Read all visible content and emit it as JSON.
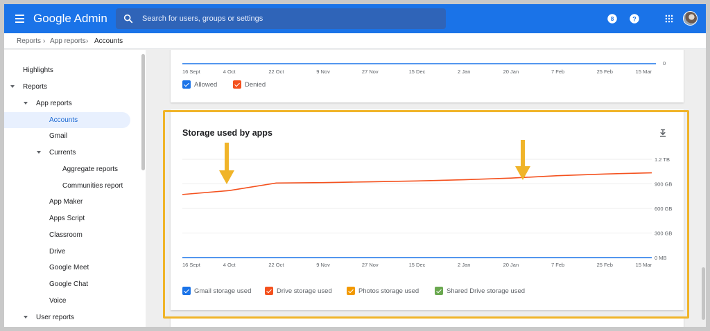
{
  "header": {
    "app_title": "Google Admin",
    "search_placeholder": "Search for users, groups or settings"
  },
  "breadcrumb": [
    "Reports",
    "App reports",
    "Accounts"
  ],
  "sidebar": {
    "items": [
      {
        "label": "Highlights"
      },
      {
        "label": "Reports"
      },
      {
        "label": "App reports"
      },
      {
        "label": "Accounts"
      },
      {
        "label": "Gmail"
      },
      {
        "label": "Currents"
      },
      {
        "label": "Aggregate reports"
      },
      {
        "label": "Communities report"
      },
      {
        "label": "App Maker"
      },
      {
        "label": "Apps Script"
      },
      {
        "label": "Classroom"
      },
      {
        "label": "Drive"
      },
      {
        "label": "Google Meet"
      },
      {
        "label": "Google Chat"
      },
      {
        "label": "Voice"
      },
      {
        "label": "User reports"
      }
    ],
    "active": "Accounts"
  },
  "top_card": {
    "x_ticks": [
      "16 Sept",
      "4 Oct",
      "22 Oct",
      "9 Nov",
      "27 Nov",
      "15 Dec",
      "2 Jan",
      "20 Jan",
      "7 Feb",
      "25 Feb",
      "15 Mar"
    ],
    "y_tick": "0",
    "legend": [
      {
        "label": "Allowed",
        "color": "#1a73e8"
      },
      {
        "label": "Denied",
        "color": "#f4511e"
      }
    ]
  },
  "chart_data": {
    "type": "line",
    "title": "Storage used by apps",
    "x_ticks": [
      "16 Sept",
      "4 Oct",
      "22 Oct",
      "9 Nov",
      "27 Nov",
      "15 Dec",
      "2 Jan",
      "20 Jan",
      "7 Feb",
      "25 Feb",
      "15 Mar"
    ],
    "y_ticks": [
      "0 MB",
      "300 GB",
      "600 GB",
      "900 GB",
      "1.2 TB"
    ],
    "ylim_gb": [
      0,
      1200
    ],
    "grid": true,
    "legend_position": "bottom",
    "series": [
      {
        "name": "Gmail storage used",
        "color": "#1a73e8",
        "values": [
          0,
          0,
          0,
          0,
          0,
          0,
          0,
          0,
          0,
          0,
          0
        ]
      },
      {
        "name": "Drive storage used",
        "color": "#f4511e",
        "values": [
          770,
          818,
          910,
          915,
          925,
          935,
          950,
          970,
          1000,
          1020,
          1035
        ]
      },
      {
        "name": "Photos storage used",
        "color": "#f29900",
        "values": []
      },
      {
        "name": "Shared Drive storage used",
        "color": "#6aa84f",
        "values": []
      }
    ]
  },
  "annotation_color": "#f0b429"
}
